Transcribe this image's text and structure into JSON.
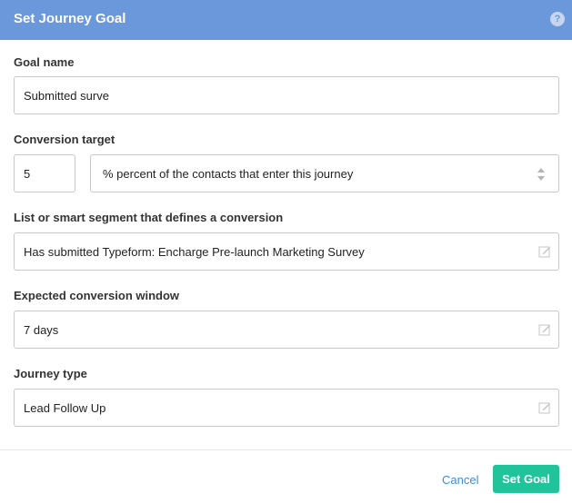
{
  "header": {
    "title": "Set Journey Goal",
    "help_icon": "question-circle-icon"
  },
  "goal_name": {
    "label": "Goal name",
    "value": "Submitted surve"
  },
  "conversion_target": {
    "label": "Conversion target",
    "value": "5",
    "unit_selected": "% percent of the contacts that enter this journey"
  },
  "segment": {
    "label": "List or smart segment that defines a conversion",
    "value": "Has submitted Typeform: Encharge Pre-launch Marketing Survey",
    "icon": "edit-icon"
  },
  "conversion_window": {
    "label": "Expected conversion window",
    "value": "7 days",
    "icon": "edit-icon"
  },
  "journey_type": {
    "label": "Journey type",
    "value": "Lead Follow Up",
    "icon": "edit-icon"
  },
  "footer": {
    "cancel_label": "Cancel",
    "submit_label": "Set Goal"
  },
  "colors": {
    "header": "#6b97db",
    "primary_button": "#20c39a",
    "link": "#3c8dd5"
  }
}
